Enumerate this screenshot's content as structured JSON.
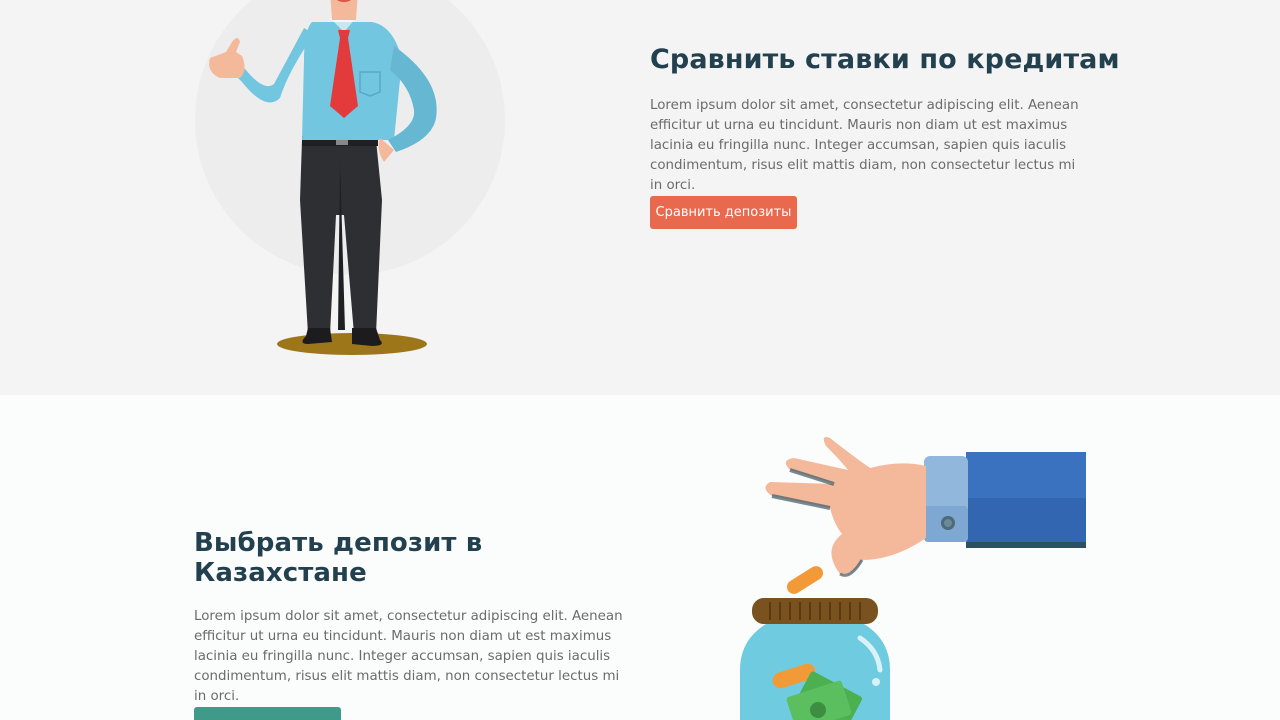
{
  "section1": {
    "title": "Сравнить ставки по кредитам",
    "text": "Lorem ipsum dolor sit amet, consectetur adipiscing elit. Aenean efficitur ut urna eu tincidunt. Mauris non diam ut est maximus lacinia eu fringilla nunc. Integer accumsan, sapien quis iaculis condimentum, risus elit mattis diam, non consectetur lectus mi in orci.",
    "button_label": "Сравнить депозиты",
    "button_color": "#e8694d",
    "illustration_icon": "businessman-thumbs-up-illustration"
  },
  "section2": {
    "title": "Выбрать депозит в Казахстане",
    "text": "Lorem ipsum dolor sit amet, consectetur adipiscing elit. Aenean efficitur ut urna eu tincidunt. Mauris non diam ut est maximus lacinia eu fringilla nunc. Integer accumsan, sapien quis iaculis condimentum, risus elit mattis diam, non consectetur lectus mi in orci.",
    "button_color": "#3f9a8a",
    "illustration_icon": "hand-dropping-coin-into-jar-illustration"
  },
  "colors": {
    "heading": "#23404f",
    "text": "#6b6b6b",
    "section1_bg": "#f4f4f5",
    "section2_bg": "#fbfcfc"
  }
}
